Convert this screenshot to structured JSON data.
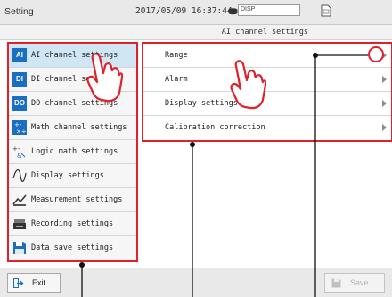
{
  "header": {
    "title": "Setting",
    "datetime": "2017/05/09 16:37:44",
    "disp_label": "DISP"
  },
  "subheader": {
    "text": "AI channel settings"
  },
  "left_menu": {
    "items": [
      {
        "label": "AI channel settings",
        "icon": "AI",
        "selected": true
      },
      {
        "label": "DI channel settings",
        "icon": "DI"
      },
      {
        "label": "DO channel settings",
        "icon": "DO"
      },
      {
        "label": "Math channel settings",
        "icon": "math-icon"
      },
      {
        "label": "Logic math settings",
        "icon": "logic-math-icon"
      },
      {
        "label": "Display settings",
        "icon": "wave-icon"
      },
      {
        "label": "Measurement settings",
        "icon": "measurement-icon"
      },
      {
        "label": "Recording settings",
        "icon": "recording-icon"
      },
      {
        "label": "Data save settings",
        "icon": "data-save-icon"
      }
    ]
  },
  "right_list": {
    "items": [
      {
        "label": "Range"
      },
      {
        "label": "Alarm"
      },
      {
        "label": "Display settings"
      },
      {
        "label": "Calibration correction"
      }
    ]
  },
  "footer": {
    "exit_label": "Exit",
    "save_label": "Save"
  },
  "colors": {
    "highlight": "#e0202a",
    "selected_bg": "#cfe6f5",
    "badge_blue": "#1b6fc2"
  }
}
